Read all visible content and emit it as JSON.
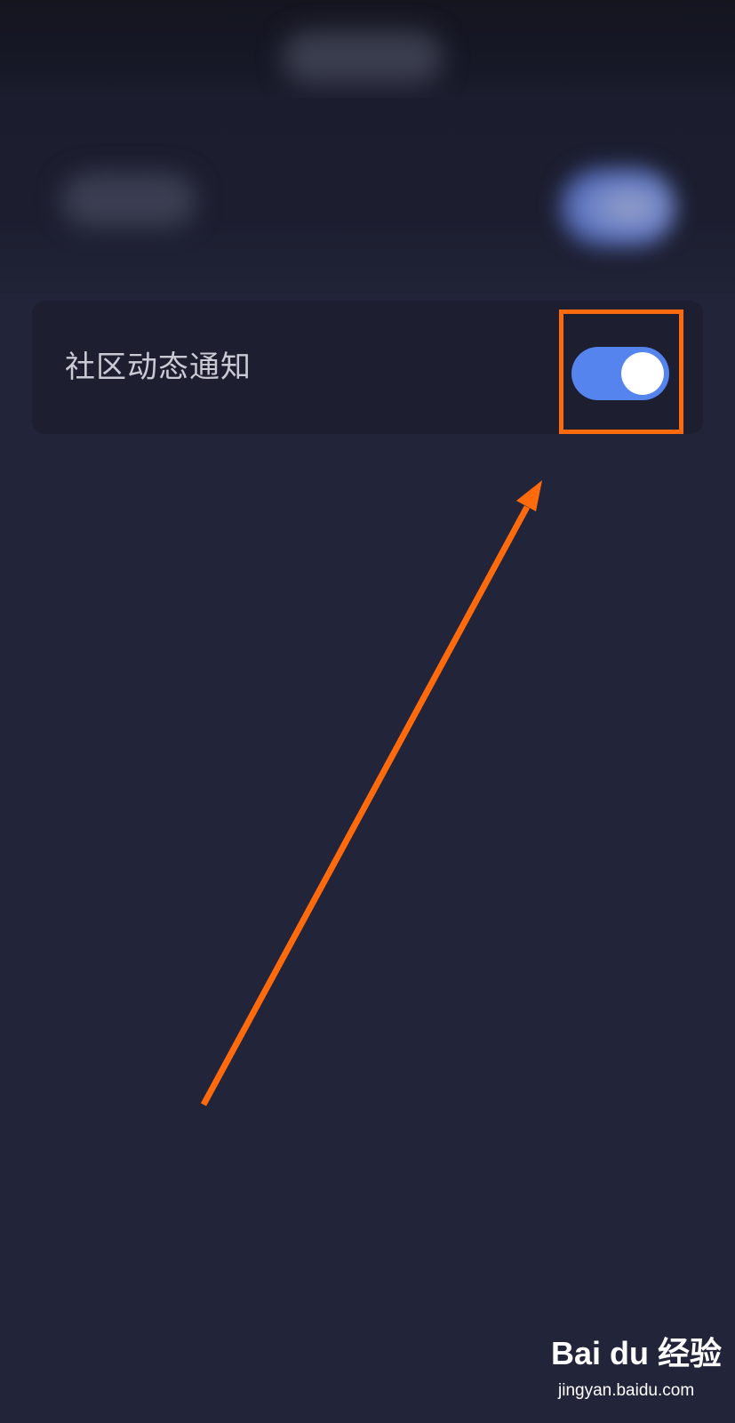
{
  "settings": {
    "community_notification": {
      "label": "社区动态通知",
      "enabled": true
    }
  },
  "colors": {
    "background": "#22243a",
    "card": "#1d1f31",
    "toggle_on": "#5684ee",
    "annotation": "#ff6a0d"
  },
  "watermark": {
    "logo_text": "Bai du 经验",
    "url": "jingyan.baidu.com"
  }
}
